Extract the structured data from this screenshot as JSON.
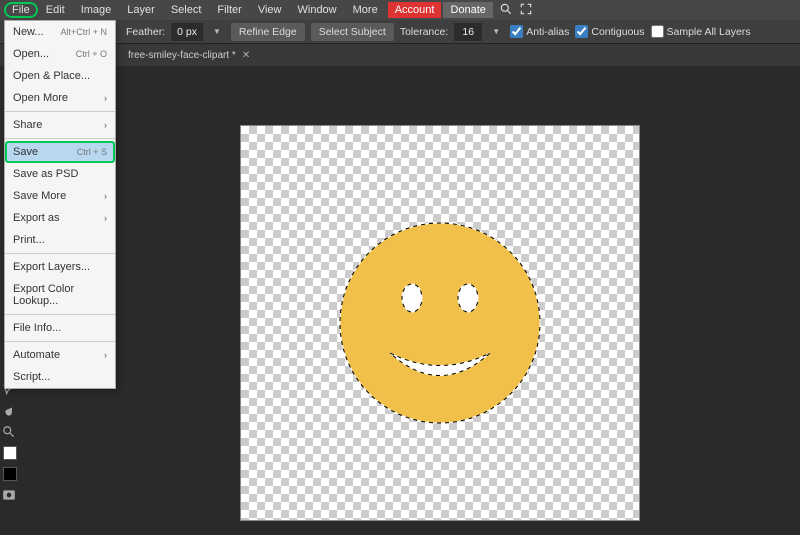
{
  "menubar": {
    "items": [
      "File",
      "Edit",
      "Image",
      "Layer",
      "Select",
      "Filter",
      "View",
      "Window",
      "More"
    ],
    "account": "Account",
    "donate": "Donate"
  },
  "toolbar": {
    "feather_label": "Feather:",
    "feather_value": "0 px",
    "refine_edge": "Refine Edge",
    "select_subject": "Select Subject",
    "tolerance_label": "Tolerance:",
    "tolerance_value": "16",
    "antialias": "Anti-alias",
    "contiguous": "Contiguous",
    "sample_all": "Sample All Layers",
    "antialias_checked": true,
    "contiguous_checked": true,
    "sample_all_checked": false
  },
  "tab": {
    "name": "free-smiley-face-clipart *"
  },
  "file_menu": {
    "items": [
      {
        "label": "New...",
        "shortcut": "Alt+Ctrl + N"
      },
      {
        "label": "Open...",
        "shortcut": "Ctrl + O"
      },
      {
        "label": "Open & Place..."
      },
      {
        "label": "Open More",
        "submenu": true
      },
      {
        "sep": true
      },
      {
        "label": "Share",
        "submenu": true
      },
      {
        "sep": true
      },
      {
        "label": "Save",
        "shortcut": "Ctrl + S",
        "highlighted": true
      },
      {
        "label": "Save as PSD"
      },
      {
        "label": "Save More",
        "submenu": true
      },
      {
        "label": "Export as",
        "submenu": true
      },
      {
        "label": "Print..."
      },
      {
        "sep": true
      },
      {
        "label": "Export Layers..."
      },
      {
        "label": "Export Color Lookup..."
      },
      {
        "sep": true
      },
      {
        "label": "File Info..."
      },
      {
        "sep": true
      },
      {
        "label": "Automate",
        "submenu": true
      },
      {
        "label": "Script..."
      }
    ]
  },
  "canvas": {
    "smiley_color": "#f0c04a"
  }
}
